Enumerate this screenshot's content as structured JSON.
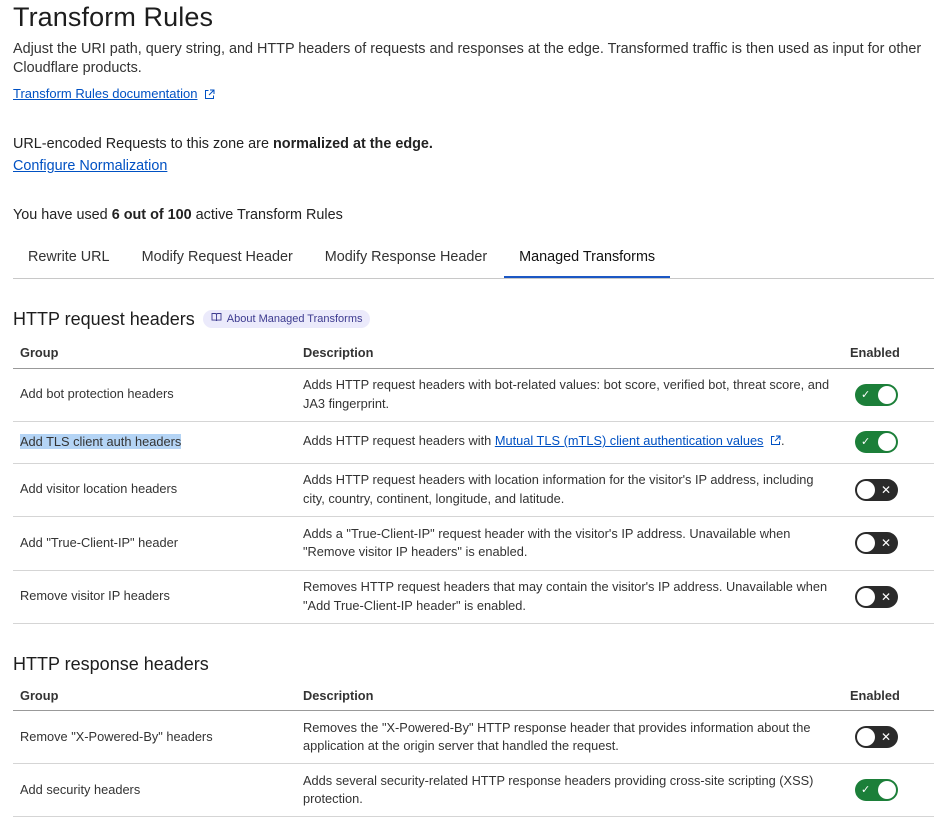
{
  "header": {
    "title": "Transform Rules",
    "intro": "Adjust the URI path, query string, and HTTP headers of requests and responses at the edge. Transformed traffic is then used as input for other Cloudflare products.",
    "doc_link": "Transform Rules documentation"
  },
  "normalization": {
    "text_prefix": "URL-encoded Requests to this zone are",
    "text_bold": "normalized at the edge.",
    "config_link": "Configure Normalization"
  },
  "usage": {
    "prefix": "You have used",
    "bold": "6 out of 100",
    "suffix": "active Transform Rules"
  },
  "tabs": [
    {
      "label": "Rewrite URL",
      "active": false
    },
    {
      "label": "Modify Request Header",
      "active": false
    },
    {
      "label": "Modify Response Header",
      "active": false
    },
    {
      "label": "Managed Transforms",
      "active": true
    }
  ],
  "request_section": {
    "title": "HTTP request headers",
    "badge": "About Managed Transforms",
    "columns": {
      "group": "Group",
      "description": "Description",
      "enabled": "Enabled"
    },
    "rows": [
      {
        "group": "Add bot protection headers",
        "description": "Adds HTTP request headers with bot-related values: bot score, verified bot, threat score, and JA3 fingerprint.",
        "enabled": true
      },
      {
        "group": "Add TLS client auth headers",
        "description_prefix": "Adds HTTP request headers with",
        "description_link": "Mutual TLS (mTLS) client authentication values",
        "description_suffix": ".",
        "enabled": true
      },
      {
        "group": "Add visitor location headers",
        "description": "Adds HTTP request headers with location information for the visitor's IP address, including city, country, continent, longitude, and latitude.",
        "enabled": false
      },
      {
        "group": "Add \"True-Client-IP\" header",
        "description": "Adds a \"True-Client-IP\" request header with the visitor's IP address. Unavailable when \"Remove visitor IP headers\" is enabled.",
        "enabled": false
      },
      {
        "group": "Remove visitor IP headers",
        "description": "Removes HTTP request headers that may contain the visitor's IP address. Unavailable when \"Add True-Client-IP header\" is enabled.",
        "enabled": false
      }
    ]
  },
  "response_section": {
    "title": "HTTP response headers",
    "columns": {
      "group": "Group",
      "description": "Description",
      "enabled": "Enabled"
    },
    "rows": [
      {
        "group": "Remove \"X-Powered-By\" headers",
        "description": "Removes the \"X-Powered-By\" HTTP response header that provides information about the application at the origin server that handled the request.",
        "enabled": false
      },
      {
        "group": "Add security headers",
        "description": "Adds several security-related HTTP response headers providing cross-site scripting (XSS) protection.",
        "enabled": true
      }
    ]
  },
  "icons": {
    "external_link": "external-link-icon",
    "book": "book-icon",
    "toggle_on": "check-icon",
    "toggle_off": "x-icon"
  },
  "colors": {
    "link": "#0051c3",
    "toggle_on": "#1c7f39",
    "toggle_off": "#2a2a2a",
    "active_tab": "#1b57c4",
    "badge_bg": "#ebeafb",
    "selection": "#b4d4f5"
  }
}
